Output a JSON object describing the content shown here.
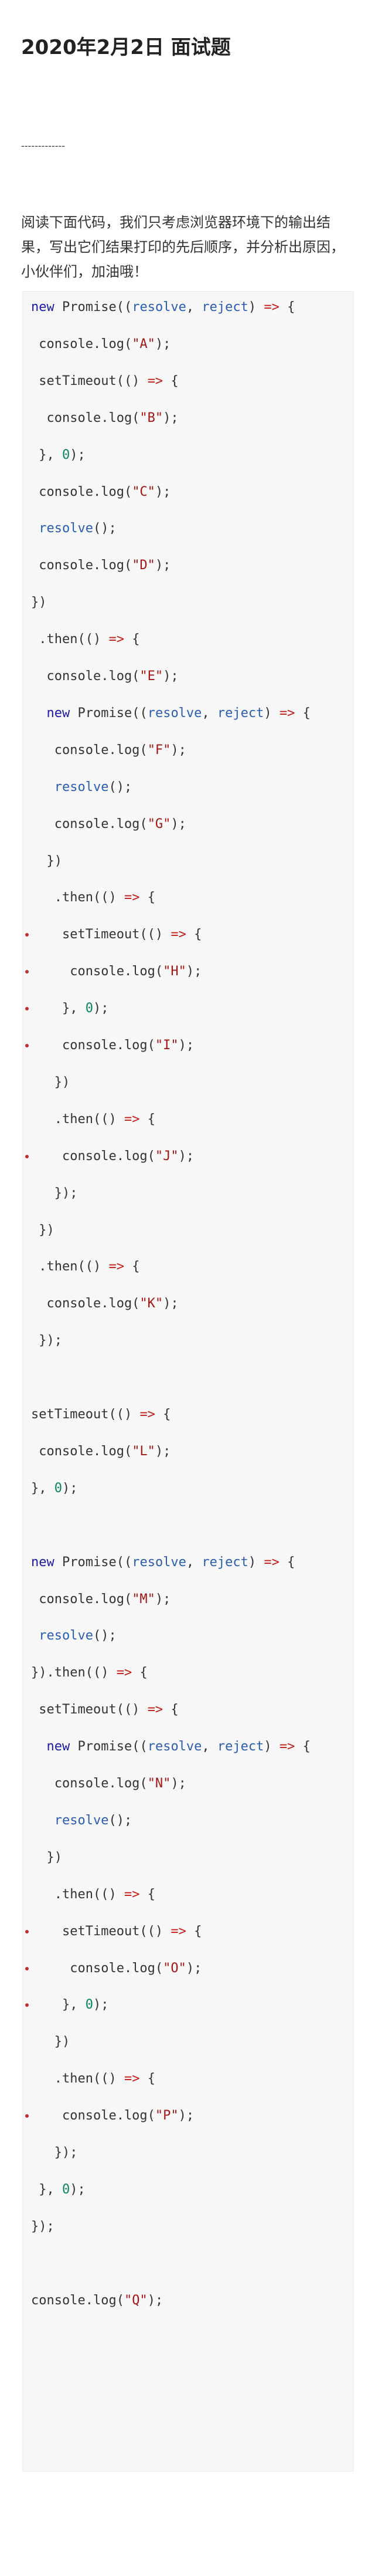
{
  "article": {
    "title": "2020年2月2日 面试题",
    "separator": "-------------",
    "intro": "阅读下面代码，我们只考虑浏览器环境下的输出结果，写出它们结果打印的先后顺序，并分析出原因，小伙伴们，加油哦！"
  },
  "code": {
    "lines": [
      {
        "text": "new Promise((resolve, reject) => {",
        "bullet": false
      },
      {
        "text": " console.log(\"A\");",
        "bullet": false
      },
      {
        "text": " setTimeout(() => {",
        "bullet": false
      },
      {
        "text": "  console.log(\"B\");",
        "bullet": false
      },
      {
        "text": " }, 0);",
        "bullet": false
      },
      {
        "text": " console.log(\"C\");",
        "bullet": false
      },
      {
        "text": " resolve();",
        "bullet": false
      },
      {
        "text": " console.log(\"D\");",
        "bullet": false
      },
      {
        "text": "})",
        "bullet": false
      },
      {
        "text": " .then(() => {",
        "bullet": false
      },
      {
        "text": "  console.log(\"E\");",
        "bullet": false
      },
      {
        "text": "  new Promise((resolve, reject) => {",
        "bullet": false
      },
      {
        "text": "   console.log(\"F\");",
        "bullet": false
      },
      {
        "text": "   resolve();",
        "bullet": false
      },
      {
        "text": "   console.log(\"G\");",
        "bullet": false
      },
      {
        "text": "  })",
        "bullet": false
      },
      {
        "text": "   .then(() => {",
        "bullet": false
      },
      {
        "text": "    setTimeout(() => {",
        "bullet": true
      },
      {
        "text": "     console.log(\"H\");",
        "bullet": true
      },
      {
        "text": "    }, 0);",
        "bullet": true
      },
      {
        "text": "    console.log(\"I\");",
        "bullet": true
      },
      {
        "text": "   })",
        "bullet": false
      },
      {
        "text": "   .then(() => {",
        "bullet": false
      },
      {
        "text": "    console.log(\"J\");",
        "bullet": true
      },
      {
        "text": "   });",
        "bullet": false
      },
      {
        "text": " })",
        "bullet": false
      },
      {
        "text": " .then(() => {",
        "bullet": false
      },
      {
        "text": "  console.log(\"K\");",
        "bullet": false
      },
      {
        "text": " });",
        "bullet": false
      },
      {
        "text": "",
        "bullet": false
      },
      {
        "text": "setTimeout(() => {",
        "bullet": false
      },
      {
        "text": " console.log(\"L\");",
        "bullet": false
      },
      {
        "text": "}, 0);",
        "bullet": false
      },
      {
        "text": "",
        "bullet": false
      },
      {
        "text": "new Promise((resolve, reject) => {",
        "bullet": false
      },
      {
        "text": " console.log(\"M\");",
        "bullet": false
      },
      {
        "text": " resolve();",
        "bullet": false
      },
      {
        "text": "}).then(() => {",
        "bullet": false
      },
      {
        "text": " setTimeout(() => {",
        "bullet": false
      },
      {
        "text": "  new Promise((resolve, reject) => {",
        "bullet": false
      },
      {
        "text": "   console.log(\"N\");",
        "bullet": false
      },
      {
        "text": "   resolve();",
        "bullet": false
      },
      {
        "text": "  })",
        "bullet": false
      },
      {
        "text": "   .then(() => {",
        "bullet": false
      },
      {
        "text": "    setTimeout(() => {",
        "bullet": true
      },
      {
        "text": "     console.log(\"O\");",
        "bullet": true
      },
      {
        "text": "    }, 0);",
        "bullet": true
      },
      {
        "text": "   })",
        "bullet": false
      },
      {
        "text": "   .then(() => {",
        "bullet": false
      },
      {
        "text": "    console.log(\"P\");",
        "bullet": true
      },
      {
        "text": "   });",
        "bullet": false
      },
      {
        "text": " }, 0);",
        "bullet": false
      },
      {
        "text": "});",
        "bullet": false
      },
      {
        "text": "",
        "bullet": false
      },
      {
        "text": "console.log(\"Q\");",
        "bullet": false
      }
    ]
  }
}
